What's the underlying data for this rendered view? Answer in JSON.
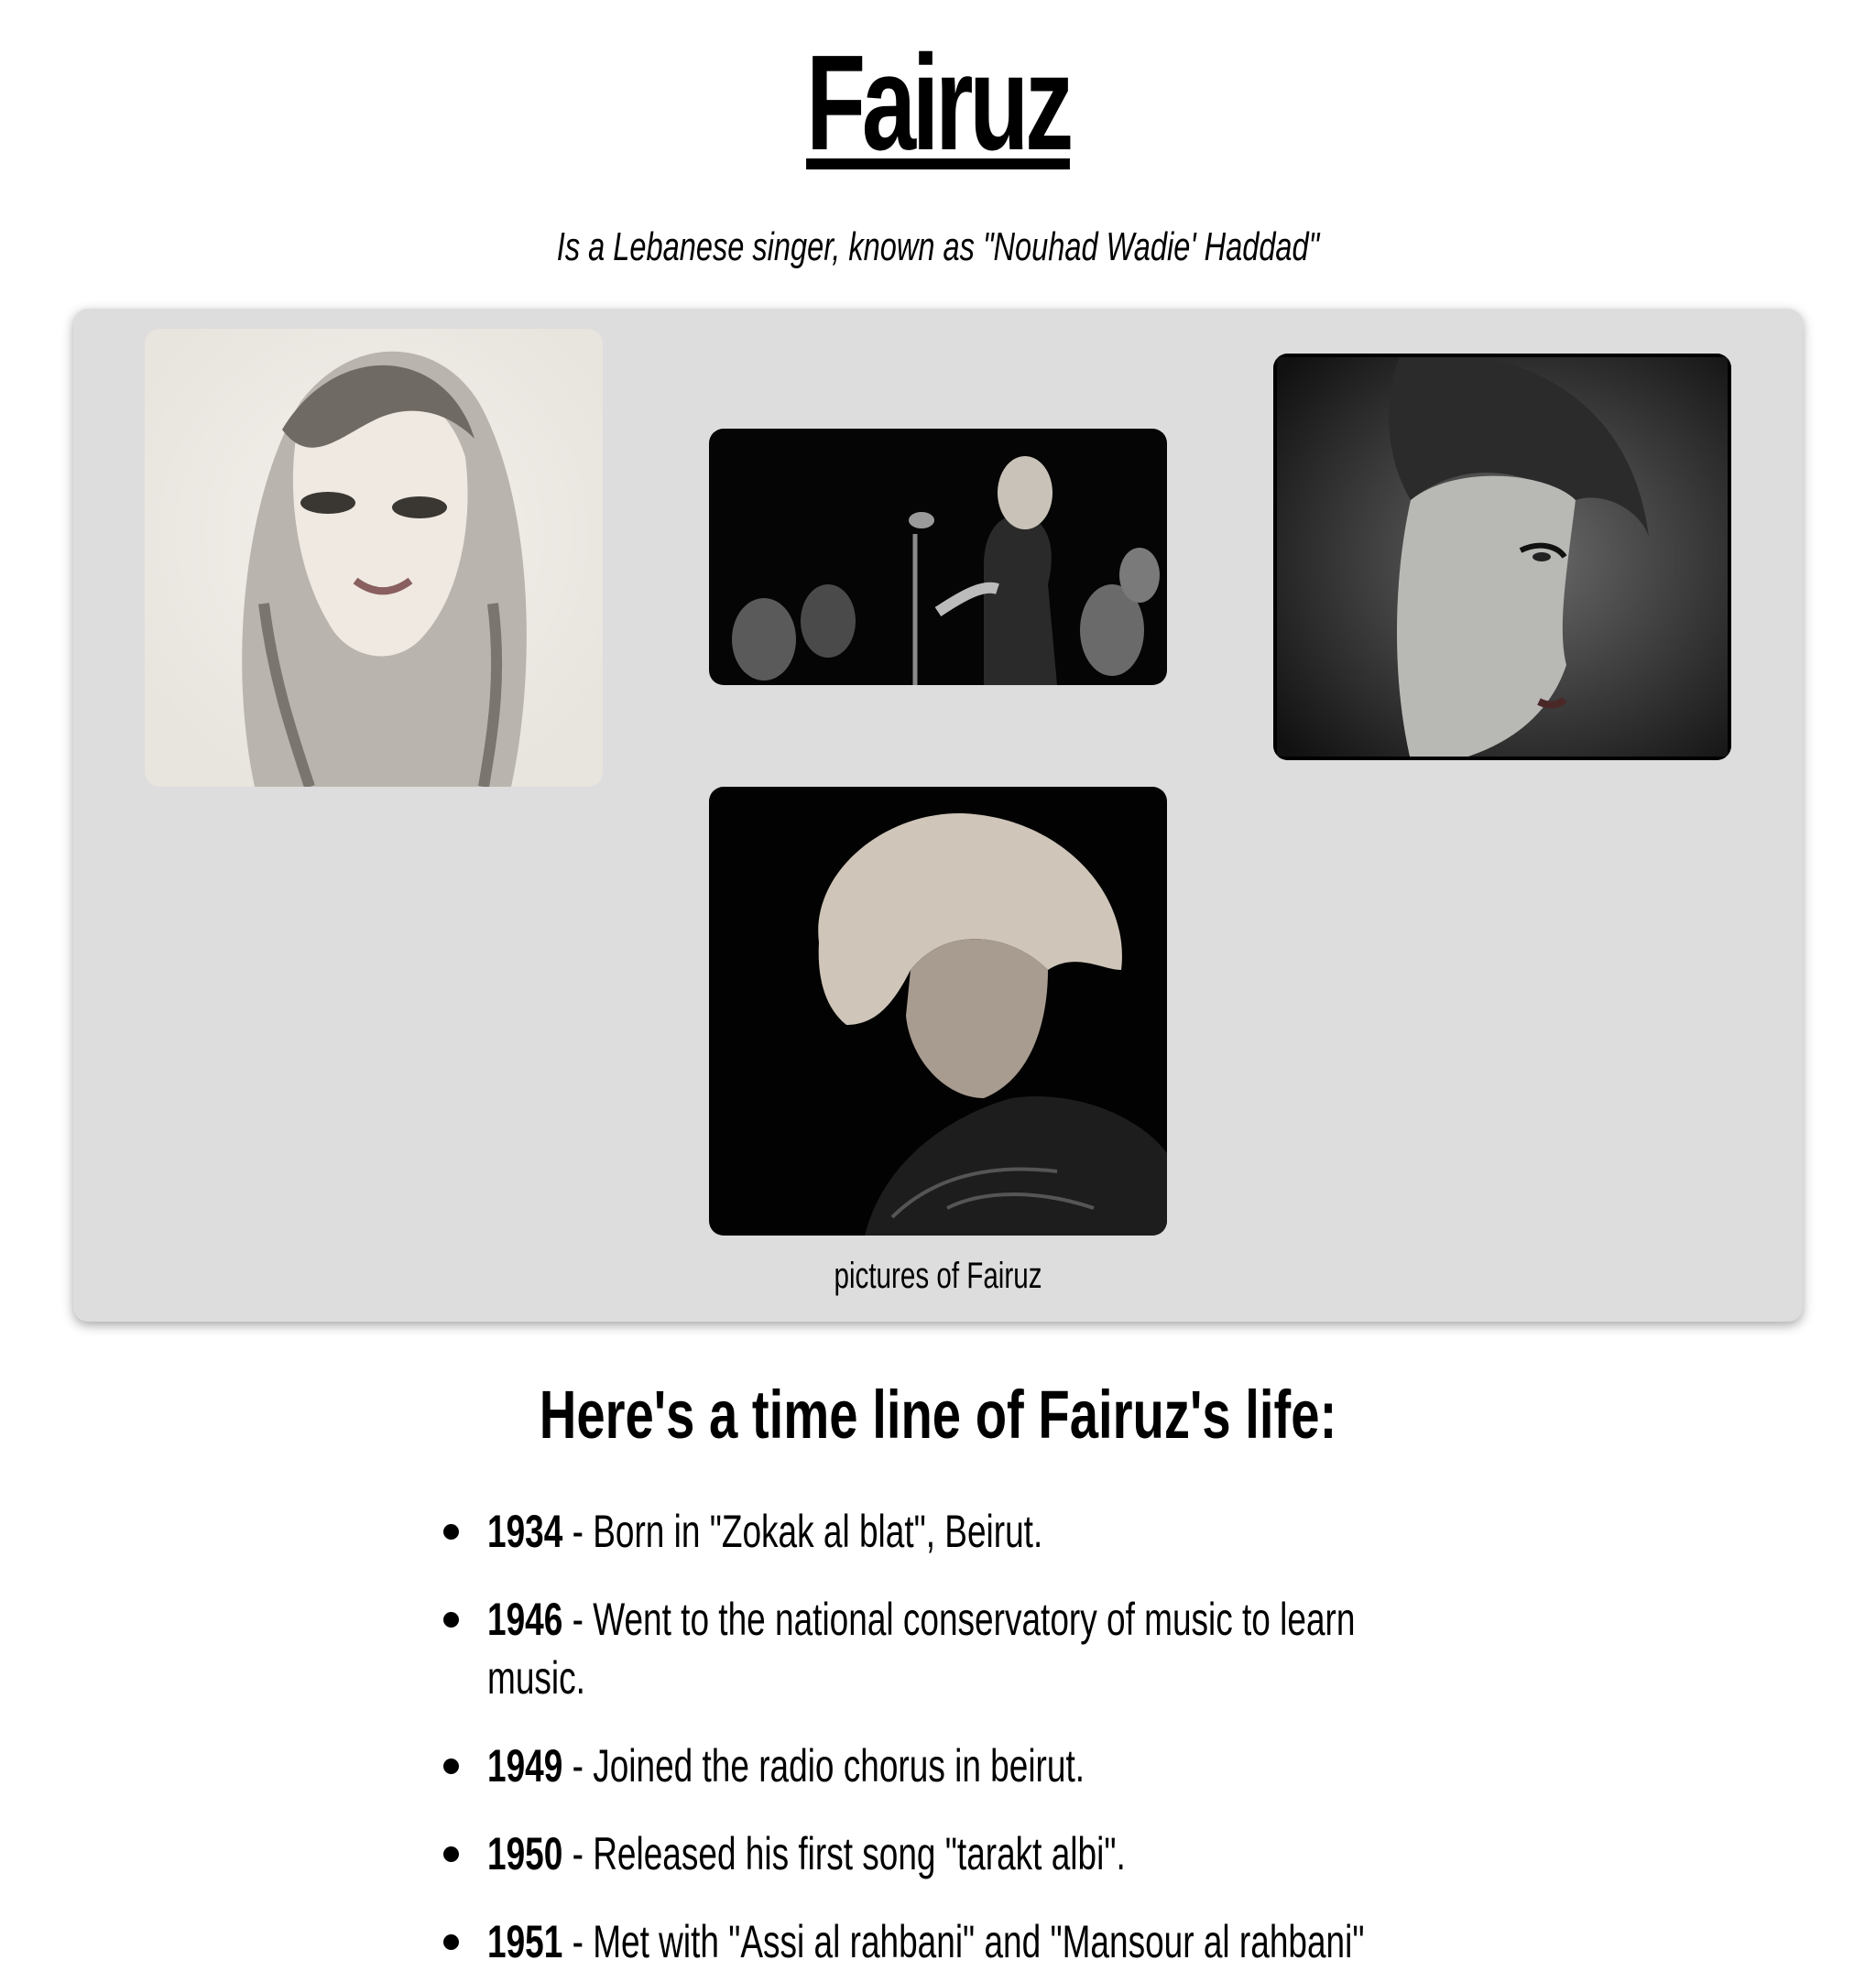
{
  "header": {
    "title": "Fairuz",
    "subtitle": "Is a Lebanese singer, known as \"Nouhad Wadie' Haddad\""
  },
  "gallery": {
    "caption": "pictures of Fairuz"
  },
  "timeline": {
    "heading": "Here's a time line of Fairuz's life:",
    "items": [
      {
        "year": "1934",
        "text": " - Born in \"Zokak al blat\", Beirut."
      },
      {
        "year": "1946",
        "text": " - Went to the national conservatory of music to learn music."
      },
      {
        "year": "1949",
        "text": " - Joined the radio chorus in beirut."
      },
      {
        "year": "1950",
        "text": " - Released his first song \"tarakt albi\"."
      },
      {
        "year": "1951",
        "text": " - Met with \"Assi al rahbani\" and \"Mansour al rahbani\""
      }
    ]
  }
}
